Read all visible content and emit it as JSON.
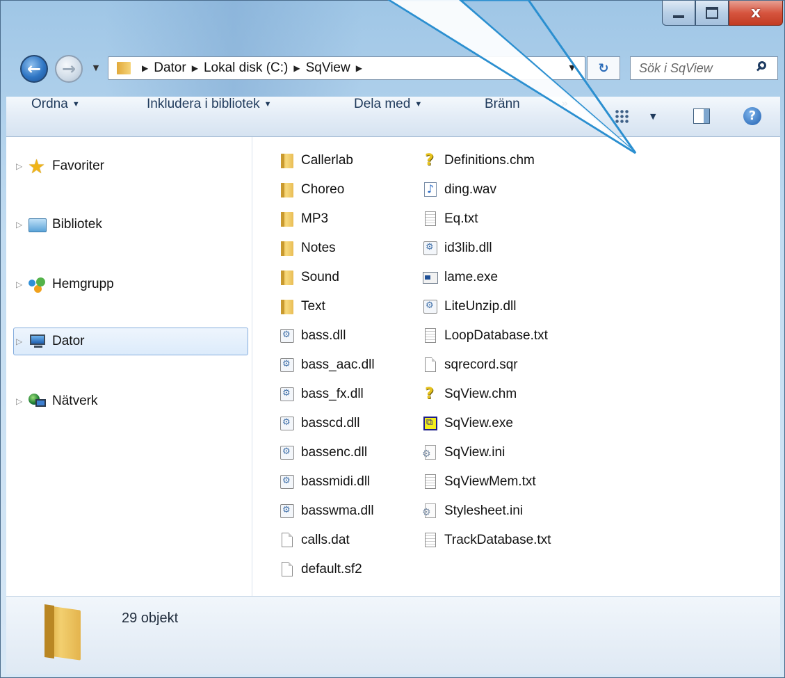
{
  "titlebar": {
    "minimize_label": "",
    "maximize_label": "",
    "close_glyph": "x"
  },
  "navigation": {
    "back_glyph": "←",
    "forward_glyph": "→",
    "recent_glyph": "▼",
    "breadcrumb": [
      "Dator",
      "Lokal disk (C:)",
      "SqView"
    ],
    "breadcrumb_sep": "▶",
    "address_dropdown_glyph": "▼",
    "refresh_glyph": "↻",
    "search_placeholder": "Sök i SqView"
  },
  "toolbar": {
    "items": [
      "Ordna",
      "Inkludera i bibliotek",
      "Dela med",
      "Bränn"
    ],
    "dropdown_glyph": "▼",
    "more_glyph": "»",
    "view_dropdown_glyph": "▼",
    "help_glyph": "?"
  },
  "navpane": {
    "items": [
      {
        "label": "Favoriter",
        "icon": "star-icon"
      },
      {
        "label": "Bibliotek",
        "icon": "library-icon"
      },
      {
        "label": "Hemgrupp",
        "icon": "homegroup-icon"
      },
      {
        "label": "Dator",
        "icon": "computer-icon",
        "selected": true
      },
      {
        "label": "Nätverk",
        "icon": "network-icon"
      }
    ],
    "expand_glyph": "▷"
  },
  "files": {
    "column1": [
      {
        "name": "Callerlab",
        "type": "folder"
      },
      {
        "name": "Choreo",
        "type": "folder"
      },
      {
        "name": "MP3",
        "type": "folder"
      },
      {
        "name": "Notes",
        "type": "folder"
      },
      {
        "name": "Sound",
        "type": "folder"
      },
      {
        "name": "Text",
        "type": "folder"
      },
      {
        "name": "bass.dll",
        "type": "dll"
      },
      {
        "name": "bass_aac.dll",
        "type": "dll"
      },
      {
        "name": "bass_fx.dll",
        "type": "dll"
      },
      {
        "name": "basscd.dll",
        "type": "dll"
      },
      {
        "name": "bassenc.dll",
        "type": "dll"
      },
      {
        "name": "bassmidi.dll",
        "type": "dll"
      },
      {
        "name": "basswma.dll",
        "type": "dll"
      },
      {
        "name": "calls.dat",
        "type": "page"
      },
      {
        "name": "default.sf2",
        "type": "page"
      }
    ],
    "column2": [
      {
        "name": "Definitions.chm",
        "type": "chm"
      },
      {
        "name": "ding.wav",
        "type": "wav"
      },
      {
        "name": "Eq.txt",
        "type": "txt"
      },
      {
        "name": "id3lib.dll",
        "type": "dll"
      },
      {
        "name": "lame.exe",
        "type": "exe"
      },
      {
        "name": "LiteUnzip.dll",
        "type": "dll"
      },
      {
        "name": "LoopDatabase.txt",
        "type": "txt"
      },
      {
        "name": "sqrecord.sqr",
        "type": "page"
      },
      {
        "name": "SqView.chm",
        "type": "chm"
      },
      {
        "name": "SqView.exe",
        "type": "sqexe"
      },
      {
        "name": "SqView.ini",
        "type": "ini"
      },
      {
        "name": "SqViewMem.txt",
        "type": "txt"
      },
      {
        "name": "Stylesheet.ini",
        "type": "ini"
      },
      {
        "name": "TrackDatabase.txt",
        "type": "txt"
      }
    ]
  },
  "status": {
    "count_text": "29 objekt"
  },
  "colors": {
    "callout": "#2b8fd0",
    "selection_border": "#84acdd",
    "window_frame": "#4a6c8c"
  }
}
